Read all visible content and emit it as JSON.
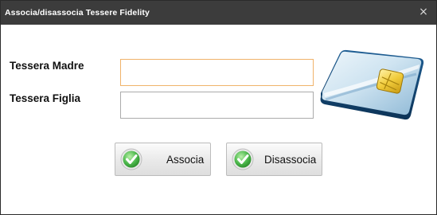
{
  "window": {
    "title": "Associa/disassocia Tessere Fidelity",
    "close_glyph": "×"
  },
  "form": {
    "madre_label": "Tessera Madre",
    "madre_value": "",
    "figlia_label": "Tessera Figlia",
    "figlia_value": ""
  },
  "buttons": {
    "associa_label": "Associa",
    "disassocia_label": "Disassocia"
  },
  "icons": {
    "close": "close-icon",
    "check": "check-icon",
    "card": "fidelity-card-icon"
  },
  "colors": {
    "titlebar": "#3c3c3c",
    "focus_border": "#f0b36a",
    "check_green": "#3aa83a"
  }
}
